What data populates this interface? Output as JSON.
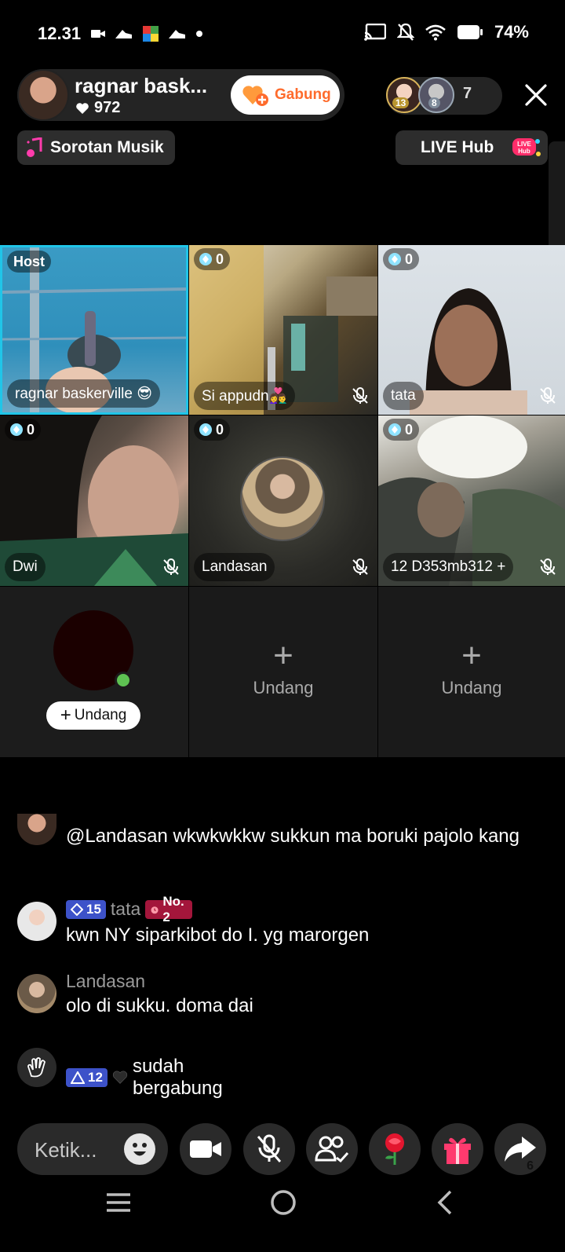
{
  "status_bar": {
    "time": "12.31",
    "battery": "74%"
  },
  "host": {
    "name": "ragnar bask...",
    "likes": "972",
    "join_label": "Gabung"
  },
  "viewers": {
    "badges": [
      "13",
      "8"
    ],
    "count": "7"
  },
  "pills": {
    "music": "Sorotan Musik",
    "live_hub": "LIVE Hub"
  },
  "grid": {
    "host_badge": "Host",
    "tiles": [
      {
        "name": "ragnar baskerville 😎",
        "score": ""
      },
      {
        "name": "Si appudn👩‍❤️‍👨",
        "score": "0"
      },
      {
        "name": "tata",
        "score": "0"
      },
      {
        "name": "Dwi",
        "score": "0"
      },
      {
        "name": "Landasan",
        "score": "0"
      },
      {
        "name": "12 D353mb312 +",
        "score": "0"
      }
    ],
    "invite_button": "Undang",
    "empty_slot_label": "Undang",
    "plus_glyph": "+"
  },
  "chat": {
    "messages": [
      {
        "user": "",
        "text": "@Landasan wkwkwkkw sukkun ma boruki pajolo kang"
      },
      {
        "user": "tata",
        "level": "15",
        "rank": "No. 2",
        "text": "kwn NY siparkibot do I. yg marorgen"
      },
      {
        "user": "Landasan",
        "text": "olo di sukku. doma dai"
      },
      {
        "level": "12",
        "text": "sudah bergabung"
      }
    ]
  },
  "bottom": {
    "input_placeholder": "Ketik...",
    "share_count": "6"
  },
  "colors": {
    "accent_cyan": "#20c5e8",
    "join_orange": "#fe6b2c",
    "level_blue": "#3d52c9",
    "rank_red": "#a3163b"
  }
}
